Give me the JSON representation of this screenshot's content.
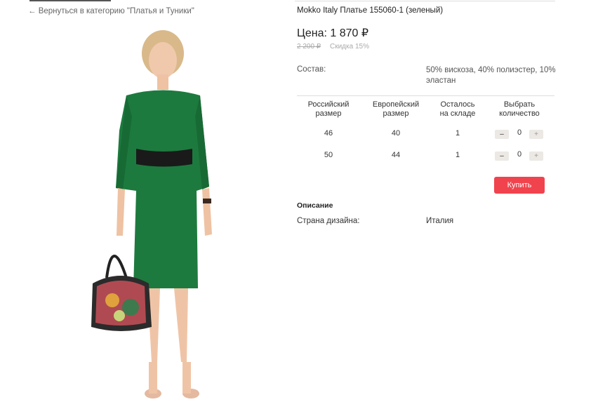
{
  "nav": {
    "back_link": "← Вернуться в категорию \"Платья и Туники\""
  },
  "product": {
    "title": "Mokko Italy Платье 155060-1 (зеленый)",
    "price": "Цена: 1 870 ₽",
    "old_price": "2 200 ₽",
    "discount": "Скидка 15%",
    "composition_label": "Состав:",
    "composition_value": "50% вискоза, 40% полиэстер, 10% эластан",
    "buy_label": "Купить"
  },
  "sizes": {
    "headers": {
      "ru": [
        "Российский",
        "размер"
      ],
      "eu": [
        "Европейский",
        "размер"
      ],
      "stock": [
        "Осталось",
        "на складе"
      ],
      "qty": [
        "Выбрать",
        "количество"
      ]
    },
    "rows": [
      {
        "ru": "46",
        "eu": "40",
        "stock": "1",
        "qty": "0"
      },
      {
        "ru": "50",
        "eu": "44",
        "stock": "1",
        "qty": "0"
      }
    ],
    "minus": "–",
    "plus": "+"
  },
  "description": {
    "heading": "Описание",
    "specs": [
      {
        "label": "Страна дизайна:",
        "value": "Италия"
      }
    ]
  },
  "colors": {
    "accent": "#f1434d",
    "dress": "#1d7a3e"
  }
}
